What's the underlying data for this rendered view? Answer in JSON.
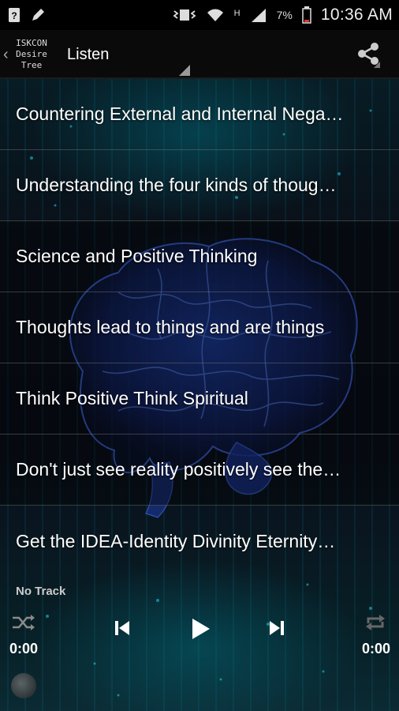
{
  "status_bar": {
    "time": "10:36 AM",
    "battery_percent": "7%",
    "network_label": "H",
    "icons": [
      "help-icon",
      "edit-icon",
      "vibrate-icon",
      "wifi-icon",
      "signal-icon",
      "battery-icon"
    ]
  },
  "action_bar": {
    "logo_text": "ISKCON\nDesire\nTree",
    "title": "Listen",
    "icons": [
      "back-chevron-icon",
      "share-icon"
    ]
  },
  "tracks": [
    {
      "title": "Countering External and Internal Nega…"
    },
    {
      "title": "Understanding the four kinds of thoug…"
    },
    {
      "title": "Science and Positive Thinking"
    },
    {
      "title": "Thoughts lead to things and are things"
    },
    {
      "title": "Think Positive Think Spiritual"
    },
    {
      "title": "Don't just see reality positively see the…"
    },
    {
      "title": "Get the IDEA-Identity Divinity Eternity…"
    }
  ],
  "player": {
    "track_label": "No Track",
    "elapsed": "0:00",
    "duration": "0:00",
    "icons": [
      "shuffle-icon",
      "previous-icon",
      "play-icon",
      "next-icon",
      "repeat-icon"
    ]
  },
  "colors": {
    "background": "#0a0d18",
    "rain_accent": "#00aac8",
    "divider": "#787878"
  }
}
